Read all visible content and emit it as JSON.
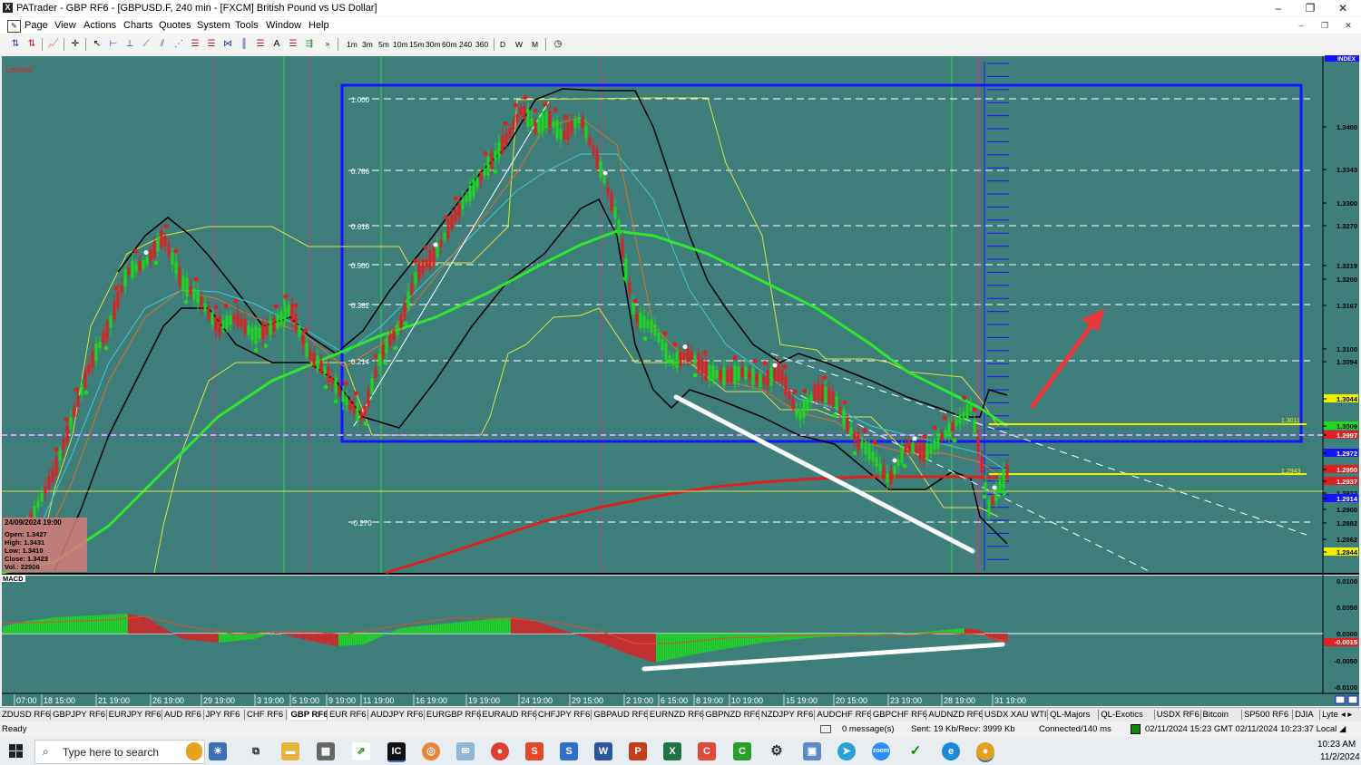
{
  "window": {
    "title": "PATrader - GBP RF6 - [GBPUSD.F, 240 min - [FXCM] British Pound vs US Dollar]",
    "minimize": "–",
    "maximize": "❐",
    "close": "✕"
  },
  "menu": [
    "Page",
    "View",
    "Actions",
    "Charts",
    "Quotes",
    "System",
    "Tools",
    "Window",
    "Help"
  ],
  "toolbar": {
    "timeframes": [
      "1m",
      "3m",
      "5m",
      "10m",
      "15m",
      "30m",
      "60m",
      "240",
      "360"
    ],
    "periods": [
      "D",
      "W",
      "M"
    ]
  },
  "chart": {
    "locked_label": "Locked",
    "index_label": "INDEX",
    "price_labels": [
      {
        "v": "1.3400",
        "hl": false
      },
      {
        "v": "1.3343",
        "hl": false
      },
      {
        "v": "1.3300",
        "hl": false
      },
      {
        "v": "1.3270",
        "hl": false
      },
      {
        "v": "1.3219",
        "hl": false
      },
      {
        "v": "1.3200",
        "hl": false
      },
      {
        "v": "1.3167",
        "hl": false
      },
      {
        "v": "1.3100",
        "hl": false
      },
      {
        "v": "1.3094",
        "hl": false
      },
      {
        "v": "1.3044",
        "hl": "yellow"
      },
      {
        "v": "1.3009",
        "hl": "green"
      },
      {
        "v": "1.2997",
        "hl": "red"
      },
      {
        "v": "1.2972",
        "hl": "blue"
      },
      {
        "v": "1.2950",
        "hl": "red"
      },
      {
        "v": "1.2937",
        "hl": "red"
      },
      {
        "v": "1.2922",
        "hl": false
      },
      {
        "v": "1.2914",
        "hl": "blue"
      },
      {
        "v": "1.2900",
        "hl": false
      },
      {
        "v": "1.2882",
        "hl": false
      },
      {
        "v": "1.2862",
        "hl": false
      },
      {
        "v": "1.2844",
        "hl": "yellow"
      }
    ],
    "fib_levels": [
      "1.000",
      "0.786",
      "0.618",
      "0.500",
      "0.382",
      "0.214",
      "-0.270"
    ],
    "inline_labels": [
      "1.3011",
      "1.2943"
    ],
    "ohlc": {
      "date": "24/09/2024 19:00",
      "open": "Open: 1.3427",
      "high": "High: 1.3431",
      "low": "Low: 1.3410",
      "close": "Close: 1.3423",
      "vol": "Vol.: 22906"
    },
    "macd": {
      "title": "MACD",
      "scale": [
        "0.0100",
        "0.0050",
        "0.0000",
        "-0.0050",
        "-0.0100"
      ],
      "current": "-0.0015"
    },
    "x_labels": [
      "07:00",
      "18 15:00",
      "21 19:00",
      "26 19:00",
      "29 19:00",
      "3 19:00",
      "5 19:00",
      "9 19:00",
      "11 19:00",
      "16 19:00",
      "19 19:00",
      "24 19:00",
      "29 15:00",
      "2 19:00",
      "6 15:00",
      "8 19:00",
      "10 19:00",
      "15 19:00",
      "20 15:00",
      "23 19:00",
      "28 19:00",
      "31 19:00"
    ],
    "colors": {
      "bg": "#3e7f7c",
      "up": "#1ed81e",
      "down": "#e01e1e",
      "ma200": "#e02020",
      "ma_green": "#2ee62e",
      "bands": "#000000",
      "envelope": "#e0e040",
      "fib_box": "#1414ff",
      "arrow": "#e83a3a"
    }
  },
  "tabs": [
    "ZDUSD RF6",
    "GBPJPY RF6",
    "EURJPY RF6",
    "AUD RF6",
    "JPY RF6",
    "CHF RF6",
    "GBP RF6",
    "EUR RF6",
    "AUDJPY RF6",
    "EURGBP RF6",
    "EURAUD RF6",
    "CHFJPY RF6",
    "GBPAUD RF6",
    "EURNZD RF6",
    "GBPNZD RF6",
    "NZDJPY RF6",
    "AUDCHF RF6",
    "GBPCHF RF6",
    "AUDNZD RF6",
    "USDX XAU WTI",
    "QL-Majors",
    "QL-Exotics",
    "USDX RF6",
    "Bitcoin",
    "SP500 RF6",
    "DJIA",
    "Lyte"
  ],
  "active_tab": "GBP RF6",
  "status": {
    "ready": "Ready",
    "messages": "0 message(s)",
    "traffic": "Sent: 19 Kb/Recv: 3999 Kb",
    "connection": "Connected/140 ms",
    "times": "02/11/2024 15:23 GMT  02/11/2024 10:23:37 Local"
  },
  "taskbar": {
    "search_placeholder": "Type here to search",
    "time": "10:23 AM",
    "date": "11/2/2024"
  }
}
